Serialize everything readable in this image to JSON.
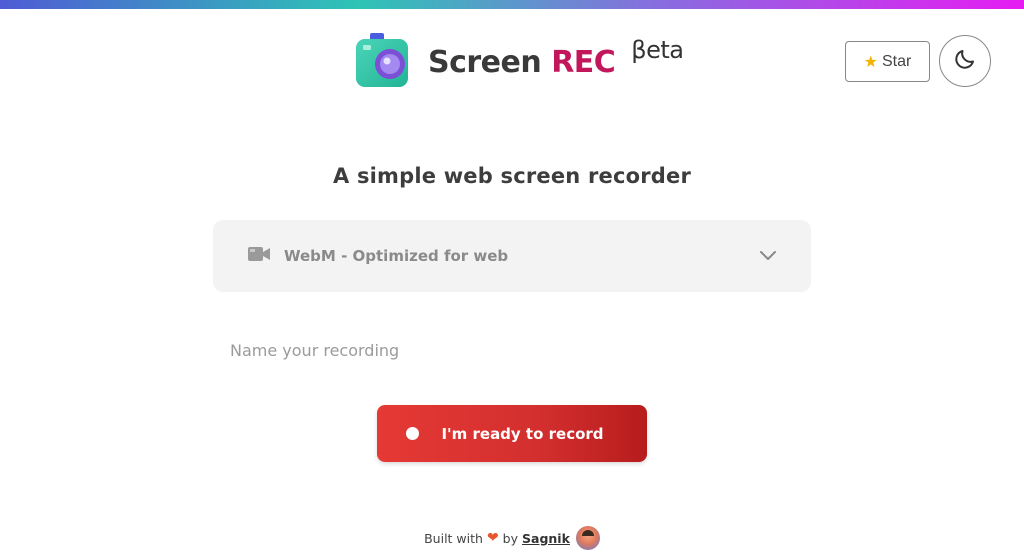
{
  "app": {
    "brand_first": "Screen",
    "brand_second": "REC",
    "brand_beta": "βeta"
  },
  "header": {
    "star_label": "Star",
    "star_icon": "star-icon",
    "theme_icon": "moon-icon"
  },
  "main": {
    "headline": "A simple web screen recorder",
    "format_select": {
      "selected": "WebM - Optimized for web",
      "icon": "video-camera-icon"
    },
    "name_input": {
      "value": "",
      "placeholder": "Name your recording"
    },
    "record_button": "I'm ready to record"
  },
  "footer": {
    "built_with": "Built with",
    "by": "by",
    "author": "Sagnik"
  },
  "colors": {
    "accent": "#d32f2f",
    "brand_rec": "#c2185b",
    "select_bg": "#f3f3f3"
  }
}
